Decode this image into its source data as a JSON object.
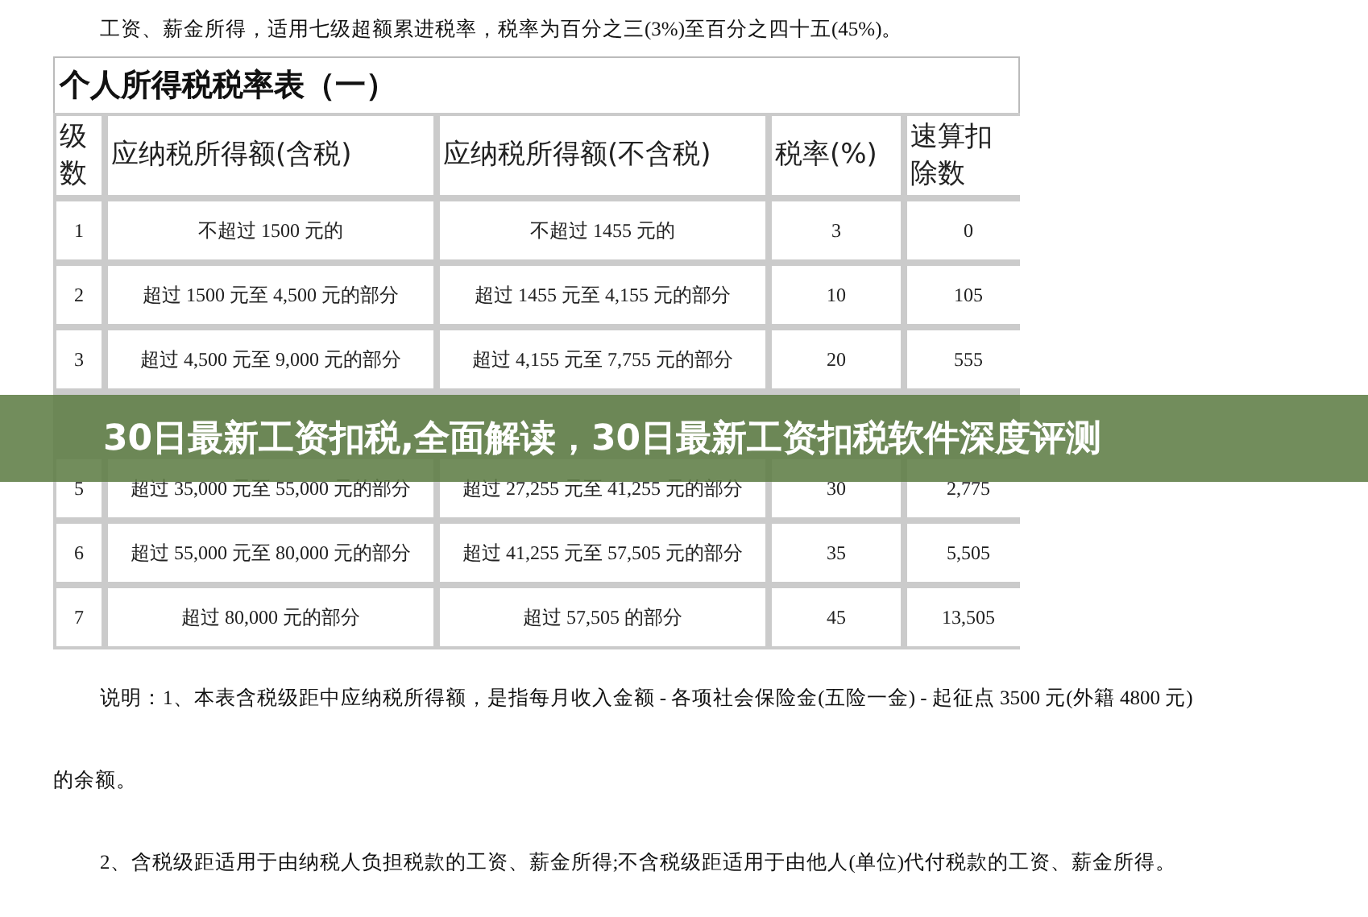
{
  "intro": "工资、薪金所得，适用七级超额累进税率，税率为百分之三(3%)至百分之四十五(45%)。",
  "table": {
    "title": "个人所得税税率表（一）",
    "columns": [
      "级数",
      "应纳税所得额(含税)",
      "应纳税所得额(不含税)",
      "税率(%)",
      "速算扣除数"
    ],
    "rows_above": [
      [
        "1",
        "不超过 1500 元的",
        "不超过 1455 元的",
        "3",
        "0"
      ],
      [
        "2",
        "超过 1500 元至 4,500 元的部分",
        "超过 1455 元至 4,155 元的部分",
        "10",
        "105"
      ],
      [
        "3",
        "超过 4,500 元至 9,000 元的部分",
        "超过 4,155 元至 7,755 元的部分",
        "20",
        "555"
      ]
    ],
    "rows_below": [
      [
        "5",
        "超过 35,000 元至 55,000 元的部分",
        "超过 27,255 元至 41,255 元的部分",
        "30",
        "2,775"
      ],
      [
        "6",
        "超过 55,000 元至 80,000 元的部分",
        "超过 41,255 元至 57,505 元的部分",
        "35",
        "5,505"
      ],
      [
        "7",
        "超过 80,000 元的部分",
        "超过 57,505 的部分",
        "45",
        "13,505"
      ]
    ]
  },
  "banner": {
    "title": "30日最新工资扣税,全面解读，30日最新工资扣税软件深度评测"
  },
  "notes": [
    "说明：1、本表含税级距中应纳税所得额，是指每月收入金额 - 各项社会保险金(五险一金) - 起征点 3500 元(外籍 4800 元)",
    "的余额。",
    "2、含税级距适用于由纳税人负担税款的工资、薪金所得;不含税级距适用于由他人(单位)代付税款的工资、薪金所得。"
  ]
}
